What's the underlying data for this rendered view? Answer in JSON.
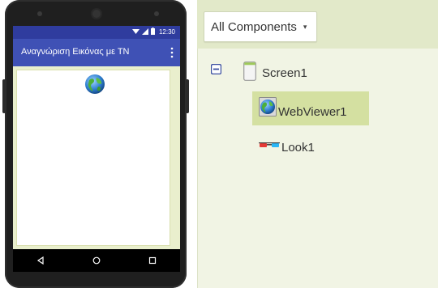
{
  "phone": {
    "status_bar": {
      "time": "12:30"
    },
    "app_title": "Αναγνώριση Εικόνας με ΤΝ",
    "overflow_icon": "more-vert-icon",
    "webview_icon": "globe-icon",
    "nav_bar": {
      "back_icon": "back-triangle-icon",
      "home_icon": "home-circle-icon",
      "recents_icon": "recents-square-icon"
    }
  },
  "components": {
    "filter_button": "All Components",
    "filter_caret": "▾",
    "tree": [
      {
        "label": "Screen1",
        "icon": "screen-icon",
        "expanded": true,
        "toggle_icon": "collapse-minus-icon"
      },
      {
        "label": "WebViewer1",
        "icon": "webviewer-globe-icon",
        "selected": true
      },
      {
        "label": "Look1",
        "icon": "look-glasses-icon",
        "selected": false
      }
    ]
  },
  "colors": {
    "status_bar": "#2f3c9e",
    "title_bar": "#3f51b5",
    "screen_bg": "#e9efcd",
    "panel_bg": "#f1f4e4",
    "panel_header": "#e2e9c9",
    "selected_row": "#d4e0a1",
    "toggle_blue": "#3a4ea0"
  }
}
